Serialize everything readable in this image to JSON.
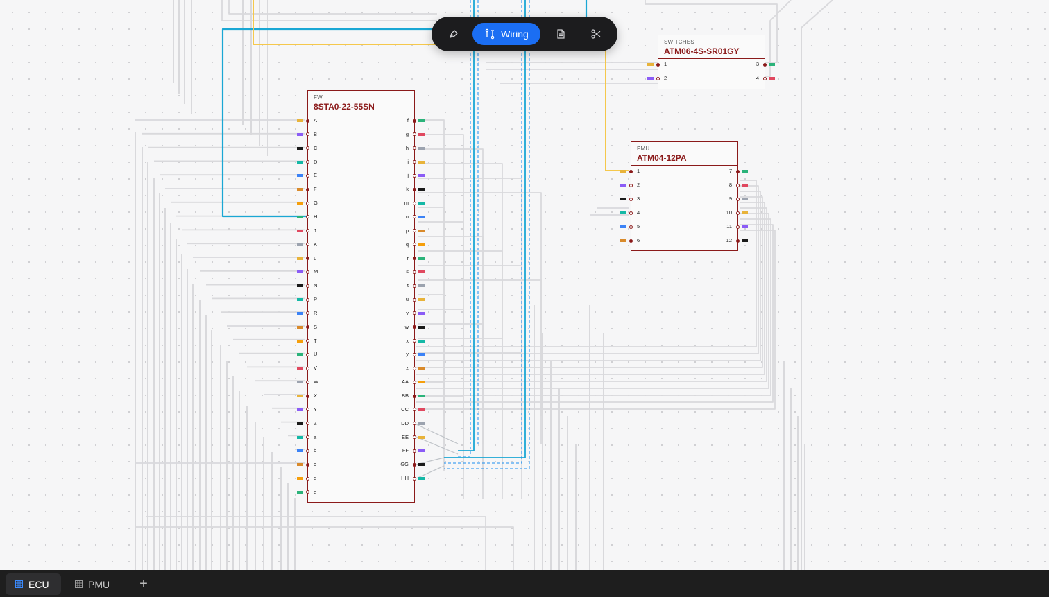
{
  "toolbar": {
    "wiring_label": "Wiring",
    "tools": [
      "pen-tool-icon",
      "wiring-icon",
      "document-icon",
      "scissors-icon"
    ]
  },
  "components": {
    "fw": {
      "category": "FW",
      "part": "8STA0-22-55SN",
      "left_pins": [
        "A",
        "B",
        "C",
        "D",
        "E",
        "F",
        "G",
        "H",
        "J",
        "K",
        "L",
        "M",
        "N",
        "P",
        "R",
        "S",
        "T",
        "U",
        "V",
        "W",
        "X",
        "Y",
        "Z",
        "a",
        "b",
        "c",
        "d",
        "e"
      ],
      "right_pins": [
        "f",
        "g",
        "h",
        "i",
        "j",
        "k",
        "m",
        "n",
        "p",
        "q",
        "r",
        "s",
        "t",
        "u",
        "v",
        "w",
        "x",
        "y",
        "z",
        "AA",
        "BB",
        "CC",
        "DD",
        "EE",
        "FF",
        "GG",
        "HH"
      ]
    },
    "switches": {
      "category": "SWITCHES",
      "part": "ATM06-4S-SR01GY",
      "left_pins": [
        "1",
        "2"
      ],
      "right_pins": [
        "3",
        "4"
      ]
    },
    "pmu": {
      "category": "PMU",
      "part": "ATM04-12PA",
      "left_pins": [
        "1",
        "2",
        "3",
        "4",
        "5",
        "6"
      ],
      "right_pins": [
        "7",
        "8",
        "9",
        "10",
        "11",
        "12"
      ]
    }
  },
  "colors": {
    "component_border": "#8b1a1a",
    "wire_blue": "#1aa7d4",
    "wire_yellow": "#f5c84c",
    "wire_dashed": "#1b8ff0",
    "accent": "#1b6ef3"
  },
  "tabs": [
    {
      "label": "ECU",
      "active": true
    },
    {
      "label": "PMU",
      "active": false
    }
  ]
}
